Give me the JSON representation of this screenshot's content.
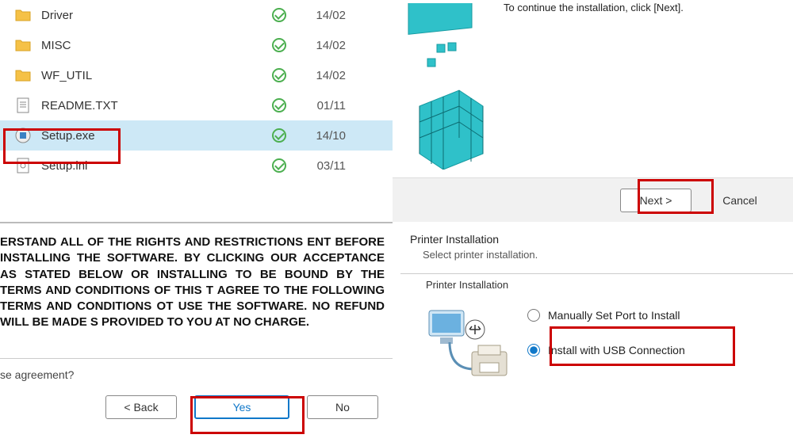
{
  "files": [
    {
      "name": "Driver",
      "date": "14/02",
      "icon": "folder"
    },
    {
      "name": "MISC",
      "date": "14/02",
      "icon": "folder"
    },
    {
      "name": "WF_UTIL",
      "date": "14/02",
      "icon": "folder"
    },
    {
      "name": "README.TXT",
      "date": "01/11",
      "icon": "text"
    },
    {
      "name": "Setup.exe",
      "date": "14/10",
      "icon": "exe",
      "selected": true
    },
    {
      "name": "Setup.ini",
      "date": "03/11",
      "icon": "ini"
    }
  ],
  "license": {
    "text": "ERSTAND ALL OF THE RIGHTS AND RESTRICTIONS ENT BEFORE INSTALLING THE SOFTWARE. BY CLICKING OUR ACCEPTANCE AS STATED BELOW OR INSTALLING TO BE BOUND BY THE TERMS AND CONDITIONS OF THIS T AGREE TO THE FOLLOWING TERMS AND CONDITIONS OT USE THE SOFTWARE.  NO REFUND WILL BE MADE S PROVIDED TO YOU AT NO CHARGE.",
    "question": "se agreement?",
    "back": "< Back",
    "yes": "Yes",
    "no": "No"
  },
  "installer_top": {
    "message": "To continue the installation, click [Next].",
    "next": "Next >",
    "cancel": "Cancel"
  },
  "installer_bottom": {
    "title": "Printer Installation",
    "subtitle": "Select printer installation.",
    "group_label": "Printer Installation",
    "option_manual": "Manually Set Port to Install",
    "option_usb": "Install with USB Connection"
  }
}
